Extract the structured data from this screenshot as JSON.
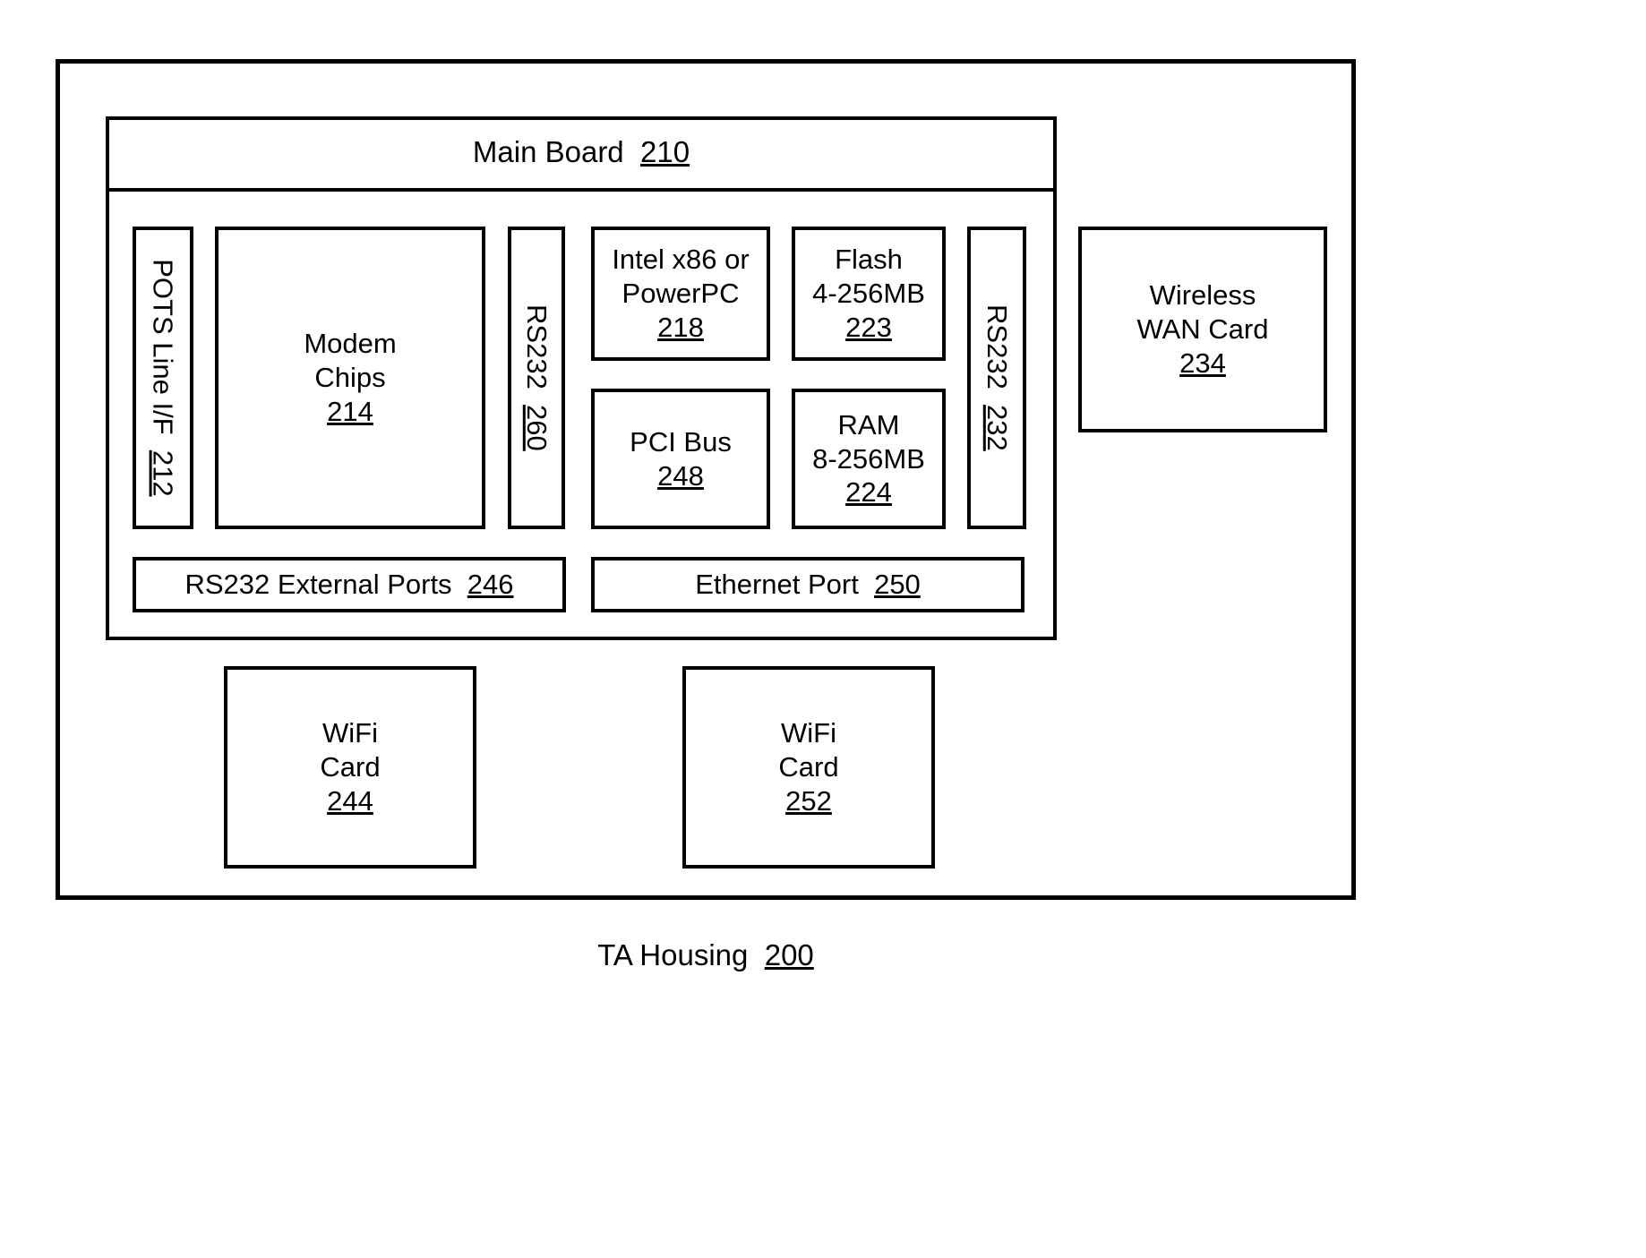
{
  "diagram": {
    "housing": {
      "label": "TA Housing",
      "ref": "200"
    },
    "main_board": {
      "label": "Main Board",
      "ref": "210"
    },
    "blocks": [
      {
        "name": "pots-line-interface",
        "label": "POTS Line I/F",
        "ref": "212",
        "orientation": "vertical"
      },
      {
        "name": "modem-chips",
        "label": "Modem\nChips",
        "ref": "214",
        "orientation": "horizontal"
      },
      {
        "name": "rs232-internal-260",
        "label": "RS232",
        "ref": "260",
        "orientation": "vertical"
      },
      {
        "name": "processor",
        "label": "Intel x86 or\nPowerPC",
        "ref": "218",
        "orientation": "horizontal"
      },
      {
        "name": "flash-memory",
        "label": "Flash\n4-256MB",
        "ref": "223",
        "orientation": "horizontal"
      },
      {
        "name": "pci-bus",
        "label": "PCI Bus",
        "ref": "248",
        "orientation": "horizontal"
      },
      {
        "name": "ram-memory",
        "label": "RAM\n8-256MB",
        "ref": "224",
        "orientation": "horizontal"
      },
      {
        "name": "rs232-internal-232",
        "label": "RS232",
        "ref": "232",
        "orientation": "vertical"
      },
      {
        "name": "rs232-external-ports",
        "label": "RS232 External Ports",
        "ref": "246",
        "orientation": "horizontal"
      },
      {
        "name": "ethernet-port",
        "label": "Ethernet Port",
        "ref": "250",
        "orientation": "horizontal"
      },
      {
        "name": "wireless-wan-card",
        "label": "Wireless\nWAN Card",
        "ref": "234",
        "orientation": "horizontal"
      },
      {
        "name": "wifi-card-244",
        "label": "WiFi\nCard",
        "ref": "244",
        "orientation": "horizontal"
      },
      {
        "name": "wifi-card-252",
        "label": "WiFi\nCard",
        "ref": "252",
        "orientation": "horizontal"
      }
    ],
    "colors": {
      "stroke": "#000000",
      "fill": "#ffffff",
      "text": "#000000"
    }
  }
}
